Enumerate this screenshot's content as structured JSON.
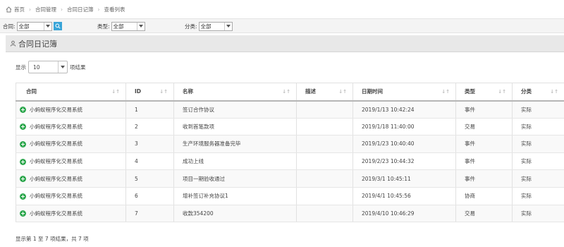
{
  "breadcrumb": [
    "首页",
    "合同管理",
    "合同日记簿",
    "查看列表"
  ],
  "icons": {
    "home": "home-icon",
    "user": "user-icon",
    "search": "search-icon",
    "row_expand": "plus-circle-icon",
    "dropdown": "chevron-down-icon"
  },
  "colors": {
    "search_button": "#3aa5d8",
    "expand_icon": "#2fa84f",
    "panel_header": "#e8e8e8"
  },
  "filters": {
    "contract": {
      "label": "合同:",
      "value": "全部"
    },
    "type": {
      "label": "类型:",
      "value": "全部"
    },
    "category": {
      "label": "分类:",
      "value": "全部"
    }
  },
  "panel": {
    "title": "合同日记簿"
  },
  "length": {
    "prefix": "显示",
    "value": "10",
    "suffix": "项结果"
  },
  "table": {
    "headers": [
      "合同",
      "ID",
      "名称",
      "描述",
      "日期时间",
      "类型",
      "分类"
    ],
    "rows": [
      {
        "contract": "小蚂蚁程序化交易系统",
        "id": "1",
        "name": "签订合作协议",
        "desc": "",
        "datetime": "2019/1/13 10:42:24",
        "type": "事件",
        "category": "实际"
      },
      {
        "contract": "小蚂蚁程序化交易系统",
        "id": "2",
        "name": "收到首笔款项",
        "desc": "",
        "datetime": "2019/1/18 11:40:00",
        "type": "交易",
        "category": "实际"
      },
      {
        "contract": "小蚂蚁程序化交易系统",
        "id": "3",
        "name": "生产环境服务器准备完毕",
        "desc": "",
        "datetime": "2019/1/23 10:40:40",
        "type": "事件",
        "category": "实际"
      },
      {
        "contract": "小蚂蚁程序化交易系统",
        "id": "4",
        "name": "成功上线",
        "desc": "",
        "datetime": "2019/2/23 10:44:32",
        "type": "事件",
        "category": "实际"
      },
      {
        "contract": "小蚂蚁程序化交易系统",
        "id": "5",
        "name": "项目一期验收通过",
        "desc": "",
        "datetime": "2019/3/1 10:45:11",
        "type": "事件",
        "category": "实际"
      },
      {
        "contract": "小蚂蚁程序化交易系统",
        "id": "6",
        "name": "增补签订补充协议1",
        "desc": "",
        "datetime": "2019/4/1 10:45:56",
        "type": "协商",
        "category": "实际"
      },
      {
        "contract": "小蚂蚁程序化交易系统",
        "id": "7",
        "name": "收款354200",
        "desc": "",
        "datetime": "2019/4/10 10:46:29",
        "type": "交易",
        "category": "实际"
      }
    ]
  },
  "info": "显示第 1 至 7 项结果，共 7 项"
}
